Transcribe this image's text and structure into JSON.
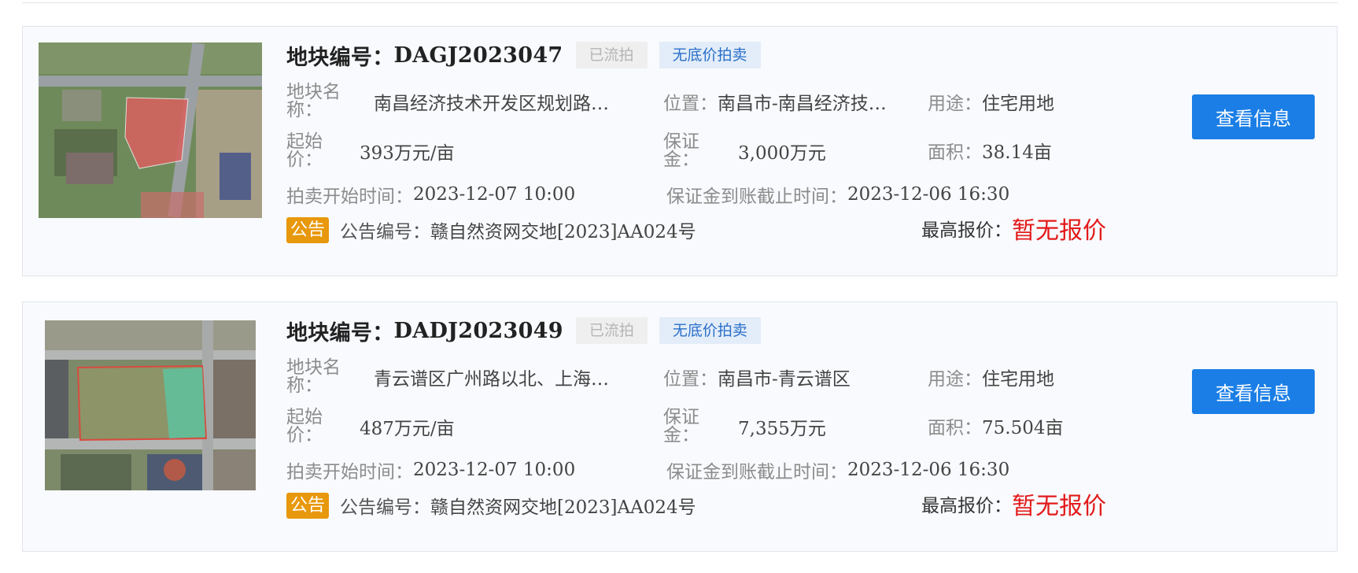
{
  "listings": [
    {
      "parcel_label": "地块编号：",
      "parcel_no": "DAGJ2023047",
      "status_tag": "已流拍",
      "type_tag": "无底价拍卖",
      "name_label": "地块名称：",
      "name_value": "南昌经济技术开发区规划路以…",
      "location_label": "位置：",
      "location_value": "南昌市-南昌经济技…",
      "use_label": "用途：",
      "use_value": "住宅用地",
      "start_price_label": "起始价：",
      "start_price_value": "393万元/亩",
      "deposit_label": "保证金：",
      "deposit_value": "3,000万元",
      "area_label": "面积：",
      "area_value": "38.14亩",
      "auction_start_label": "拍卖开始时间：",
      "auction_start_value": "2023-12-07 10:00",
      "deposit_deadline_label": "保证金到账截止时间：",
      "deposit_deadline_value": "2023-12-06 16:30",
      "notice_badge": "公告",
      "notice_label": "公告编号：",
      "notice_value": "赣自然资网交地[2023]AA024号",
      "highest_bid_label": "最高报价：",
      "highest_bid_value": "暂无报价",
      "button_label": "查看信息"
    },
    {
      "parcel_label": "地块编号：",
      "parcel_no": "DADJ2023049",
      "status_tag": "已流拍",
      "type_tag": "无底价拍卖",
      "name_label": "地块名称：",
      "name_value": "青云谱区广州路以北、上海路…",
      "location_label": "位置：",
      "location_value": "南昌市-青云谱区",
      "use_label": "用途：",
      "use_value": "住宅用地",
      "start_price_label": "起始价：",
      "start_price_value": "487万元/亩",
      "deposit_label": "保证金：",
      "deposit_value": "7,355万元",
      "area_label": "面积：",
      "area_value": "75.504亩",
      "auction_start_label": "拍卖开始时间：",
      "auction_start_value": "2023-12-07 10:00",
      "deposit_deadline_label": "保证金到账截止时间：",
      "deposit_deadline_value": "2023-12-06 16:30",
      "notice_badge": "公告",
      "notice_label": "公告编号：",
      "notice_value": "赣自然资网交地[2023]AA024号",
      "highest_bid_label": "最高报价：",
      "highest_bid_value": "暂无报价",
      "button_label": "查看信息"
    }
  ],
  "colors": {
    "primary_button": "#1a7ee6",
    "price_red": "#e31a1a",
    "notice_badge": "#e8980c",
    "tag_blue": "#2a6fc9"
  }
}
